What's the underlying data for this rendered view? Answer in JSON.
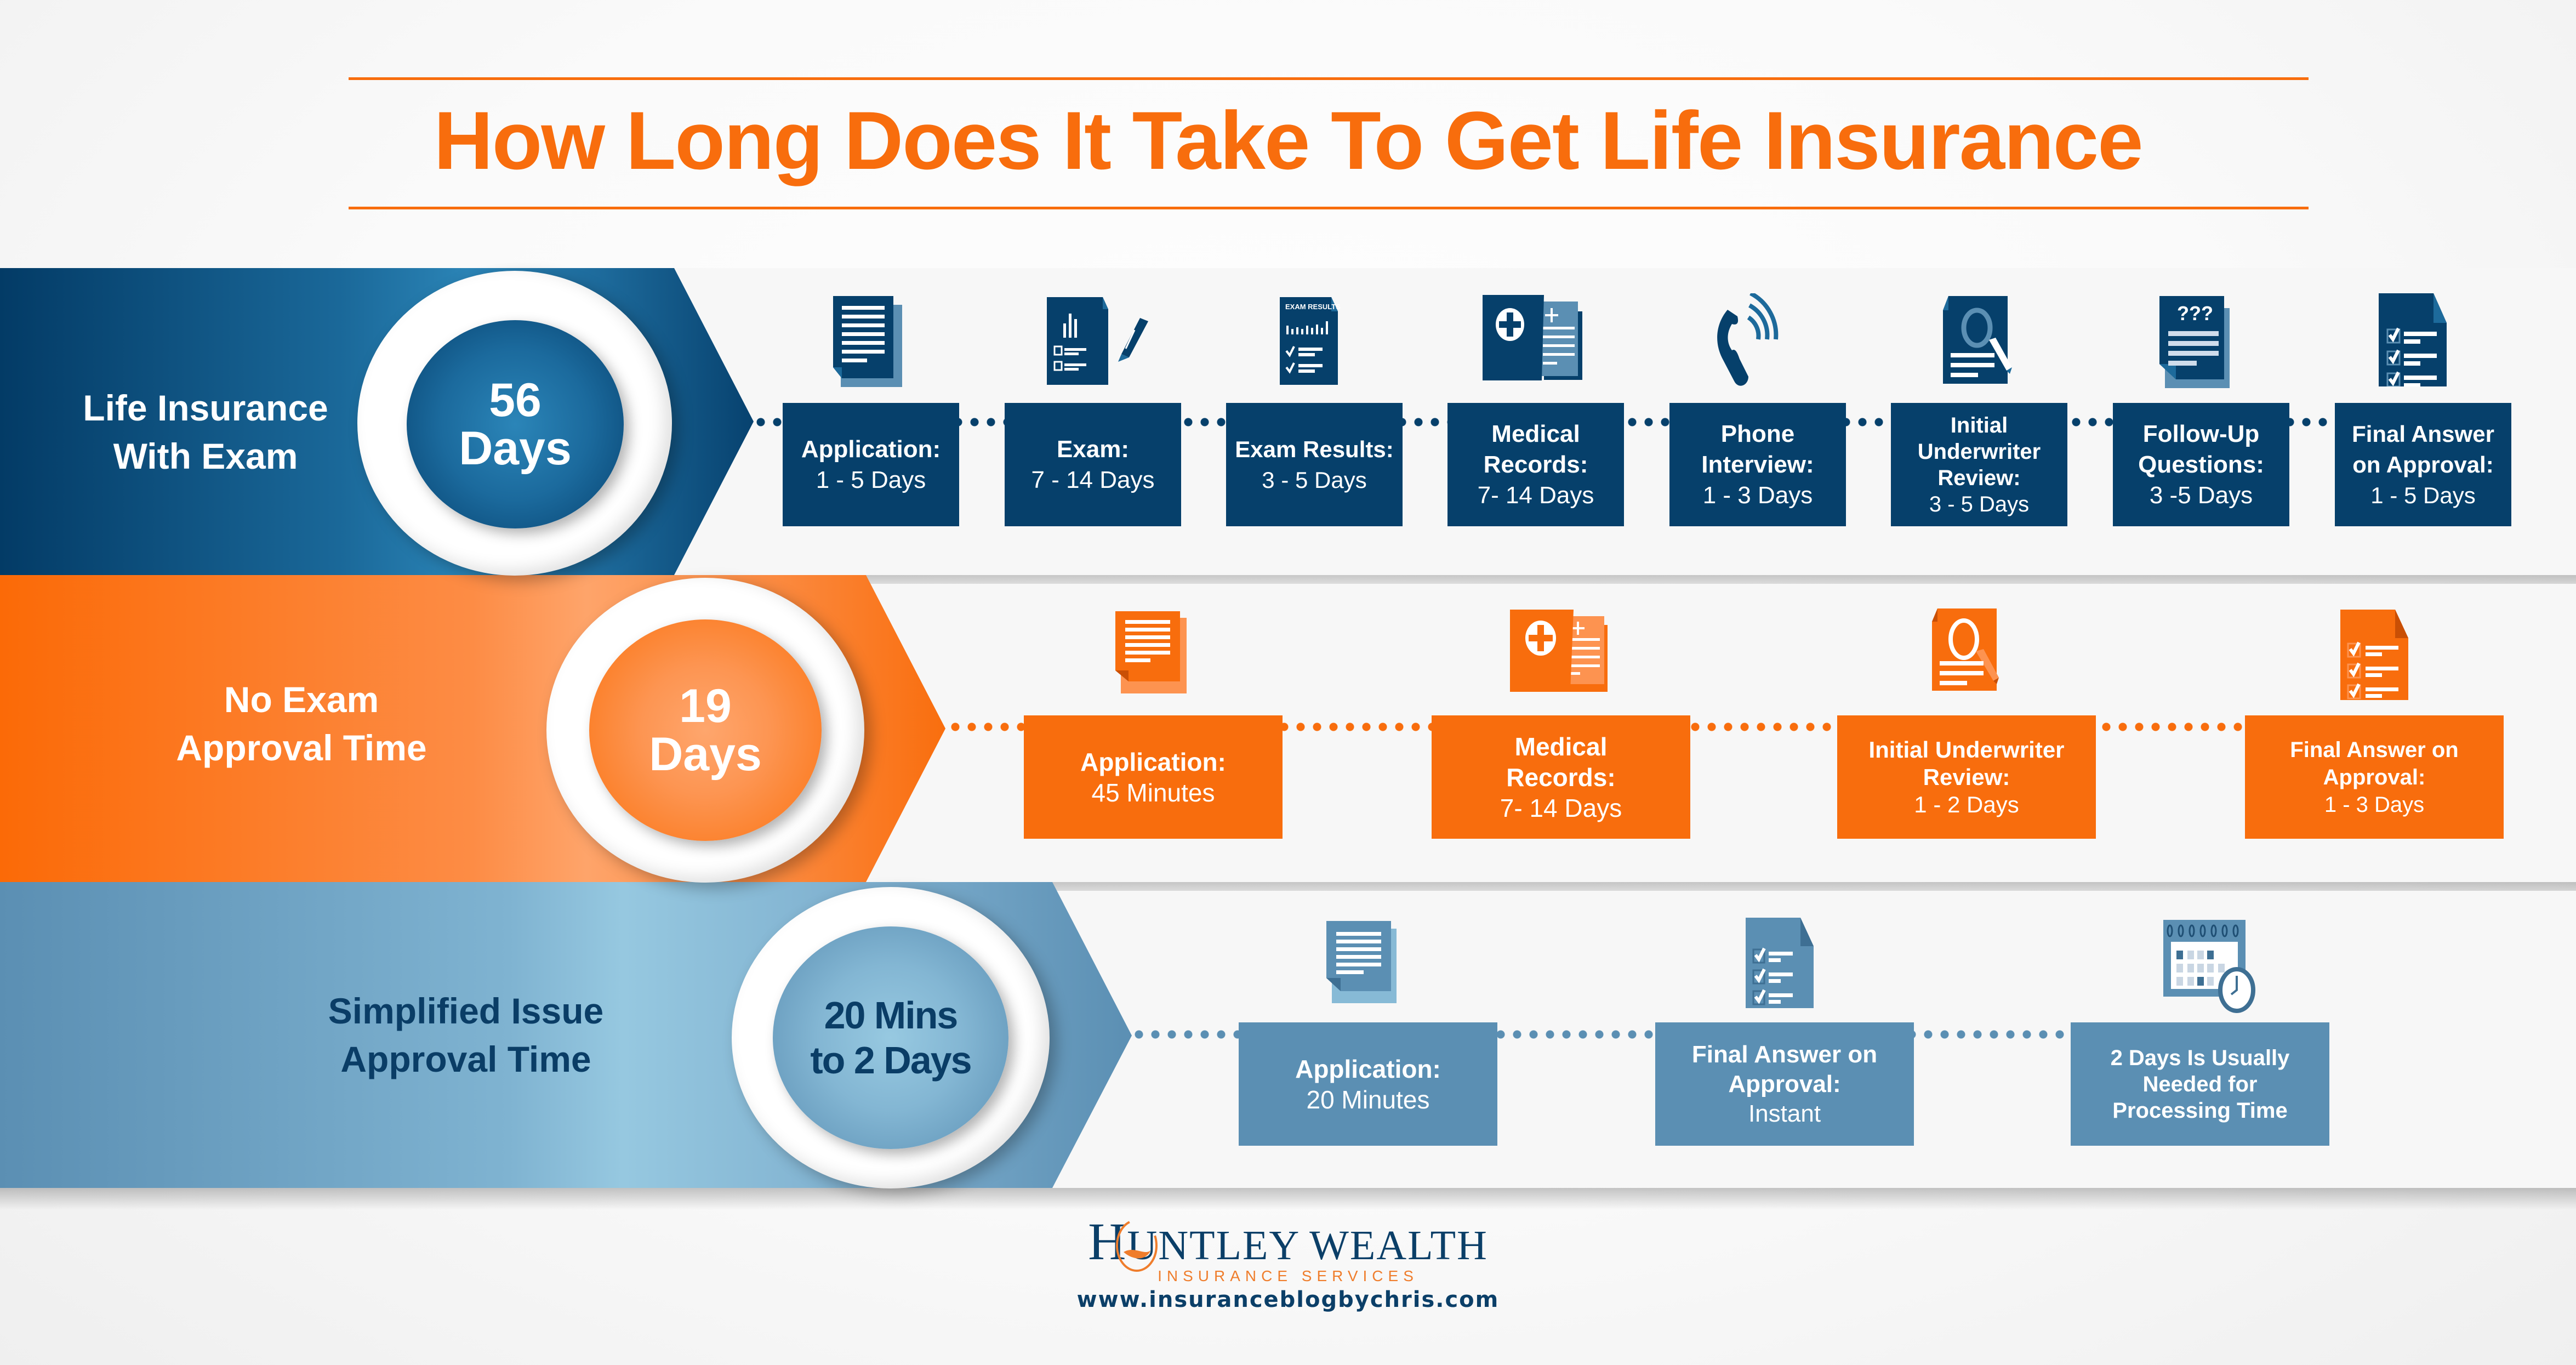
{
  "title": "How Long Does It Take To Get Life Insurance",
  "colors": {
    "orange": "#f86d0d",
    "navy": "#06406b",
    "steel_blue": "#5b8fb3",
    "light_blue": "#93c6de"
  },
  "bands": [
    {
      "label_line1": "Life Insurance",
      "label_line2": "With Exam",
      "total_line1": "56",
      "total_line2": "Days",
      "steps": [
        {
          "icon": "document-icon",
          "label": "Application:",
          "value": "1 - 5 Days"
        },
        {
          "icon": "exam-form-pencil-icon",
          "label": "Exam:",
          "value": "7 - 14 Days"
        },
        {
          "icon": "exam-results-icon",
          "label": "Exam Results:",
          "value": "3 - 5 Days",
          "icon_text": "EXAM RESULTS"
        },
        {
          "icon": "medical-records-icon",
          "label": "Medical Records:",
          "value": "7- 14 Days"
        },
        {
          "icon": "phone-icon",
          "label": "Phone Interview:",
          "value": "1 - 3 Days"
        },
        {
          "icon": "magnifier-document-icon",
          "label": "Initial Underwriter Review:",
          "value": "3 - 5 Days"
        },
        {
          "icon": "question-document-icon",
          "label": "Follow-Up Questions:",
          "value": "3 -5 Days",
          "icon_text": "???"
        },
        {
          "icon": "checklist-icon",
          "label": "Final Answer on Approval:",
          "value": "1 - 5 Days"
        }
      ]
    },
    {
      "label_line1": "No Exam",
      "label_line2": "Approval Time",
      "total_line1": "19",
      "total_line2": "Days",
      "steps": [
        {
          "icon": "document-icon",
          "label": "Application:",
          "value": "45 Minutes"
        },
        {
          "icon": "medical-records-icon",
          "label": "Medical Records:",
          "value": "7- 14 Days"
        },
        {
          "icon": "magnifier-document-icon",
          "label": "Initial Underwriter Review:",
          "value": "1 - 2 Days"
        },
        {
          "icon": "checklist-icon",
          "label": "Final Answer on Approval:",
          "value": "1 - 3 Days"
        }
      ]
    },
    {
      "label_line1": "Simplified Issue",
      "label_line2": "Approval Time",
      "total_line1": "20 Mins",
      "total_line2": "to 2 Days",
      "steps": [
        {
          "icon": "document-icon",
          "label": "Application:",
          "value": "20 Minutes"
        },
        {
          "icon": "checklist-icon",
          "label": "Final Answer on Approval:",
          "value": "Instant"
        },
        {
          "icon": "calendar-clock-icon",
          "label": "2 Days Is Usually Needed for Processing Time",
          "value": ""
        }
      ]
    }
  ],
  "footer": {
    "logo_initial": "H",
    "logo_name": "UNTLEY WEALTH",
    "logo_subtitle": "INSURANCE SERVICES",
    "url": "www.insuranceblogbychris.com"
  }
}
